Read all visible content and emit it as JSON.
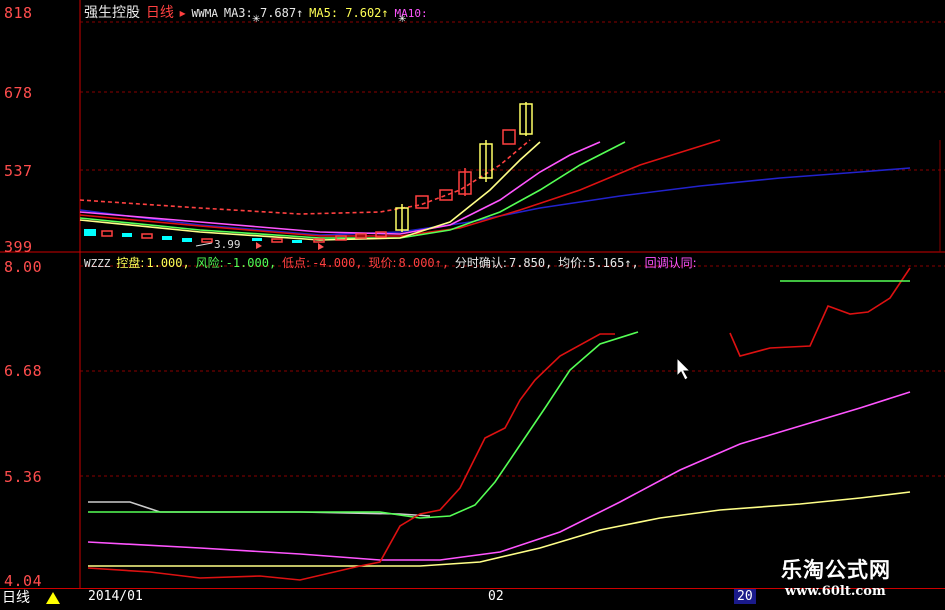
{
  "title_strip": {
    "stock_name": "强生控股",
    "period": "日线",
    "indicator": "WWMA",
    "ma3": "MA3: 7.687↑",
    "ma5": "MA5: 7.602↑",
    "ma10": "MA10:"
  },
  "price_axis": {
    "ticks": [
      "818",
      "678",
      "537",
      "399"
    ]
  },
  "low_price_label": "3.99",
  "indicator_strip": {
    "name": "WZZZ",
    "items": [
      {
        "label": "控盘:",
        "value": "1.000,",
        "color": "#ffff55"
      },
      {
        "label": "风险:",
        "value": "-1.000,",
        "color": "#55ff55"
      },
      {
        "label": "低点:",
        "value": "-4.000,",
        "color": "#ff4040"
      },
      {
        "label": "现价:",
        "value": "8.000↑,",
        "color": "#ff4040"
      },
      {
        "label": "分时确认:",
        "value": "7.850,",
        "color": "#e8e8e8"
      },
      {
        "label": "均价:",
        "value": "5.165↑,",
        "color": "#e8e8e8"
      },
      {
        "label": "回调认同:",
        "value": "",
        "color": "#ff55ff"
      }
    ]
  },
  "indicator_axis": {
    "ticks": [
      "8.00",
      "6.68",
      "5.36",
      "4.04"
    ]
  },
  "bottom": {
    "period_label": "日线",
    "date_start": "2014/01",
    "date_mid": "02",
    "date_end": "20"
  },
  "watermark": {
    "title": "乐淘公式网",
    "url": "www.60lt.com"
  },
  "colors": {
    "background": "#000000",
    "grid": "#8a0000",
    "axis_text": "#ff4d4d",
    "ma_yellow": "#ffff88",
    "ma_magenta": "#ff55ff",
    "ma_green": "#55ff55",
    "ma_red": "#dd1111",
    "ma_blue": "#2222cc"
  }
}
